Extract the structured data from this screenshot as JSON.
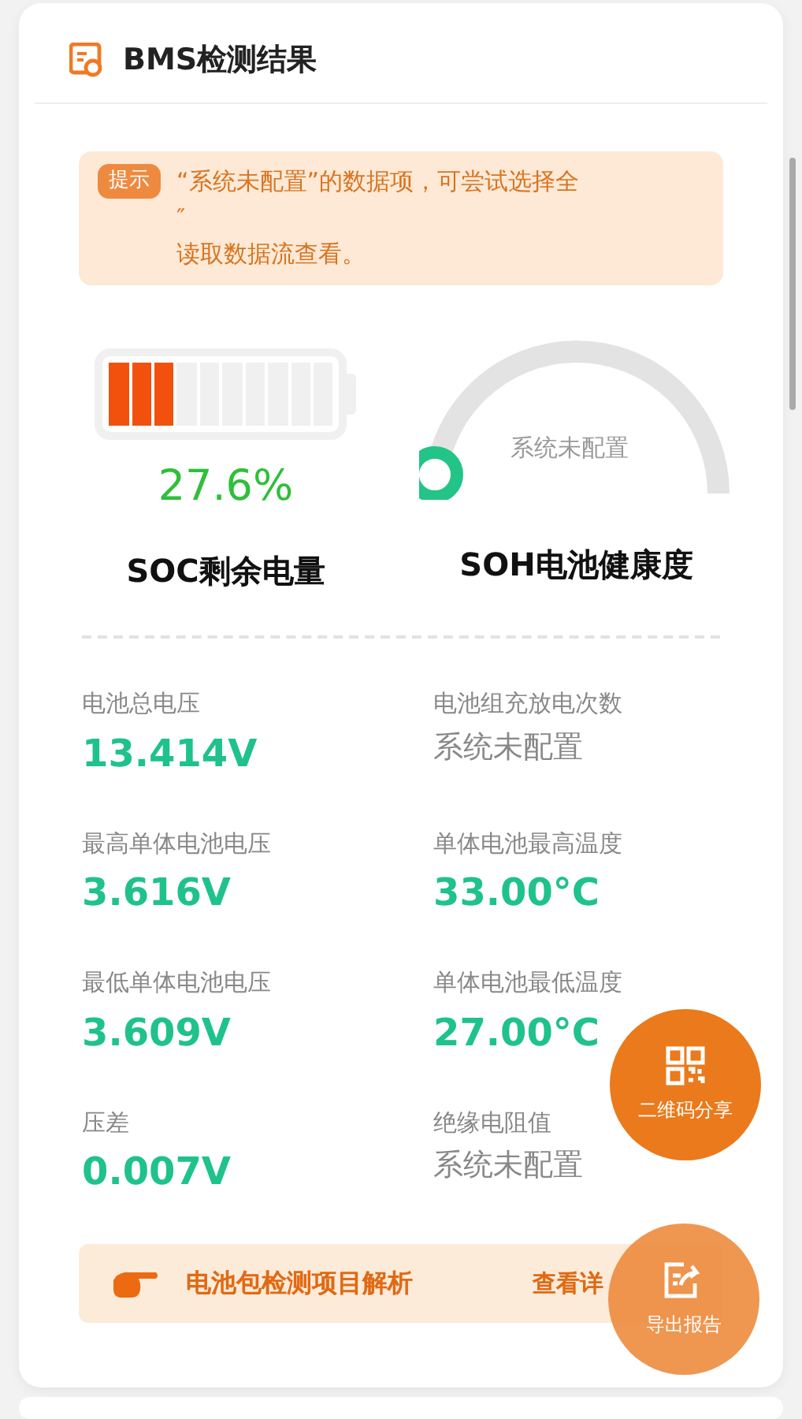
{
  "card": {
    "title": "BMS检测结果"
  },
  "hint": {
    "tag": "提示",
    "lines": [
      "“系统未配置”的数据项，可尝试选择全",
      "″",
      "读取数据流查看。"
    ]
  },
  "soc": {
    "level": 0.276,
    "reading": "27.6%",
    "label": "SOC剩余电量"
  },
  "soh": {
    "level": 0,
    "reading": "系统未配置",
    "label": "SOH电池健康度"
  },
  "metrics": [
    {
      "label": "电池总电压",
      "value": "13.414V",
      "configured": true
    },
    {
      "label": "电池组充放电次数",
      "value": "系统未配置",
      "configured": false
    },
    {
      "label": "最高单体电池电压",
      "value": "3.616V",
      "configured": true
    },
    {
      "label": "单体电池最高温度",
      "value": "33.00°C",
      "configured": true
    },
    {
      "label": "最低单体电池电压",
      "value": "3.609V",
      "configured": true
    },
    {
      "label": "单体电池最低温度",
      "value": "27.00°C",
      "configured": true
    },
    {
      "label": "压差",
      "value": "0.007V",
      "configured": true
    },
    {
      "label": "绝缘电阻值",
      "value": "系统未配置",
      "configured": false
    }
  ],
  "banner": {
    "title": "电池包检测项目解析",
    "link": "查看详"
  },
  "fabs": [
    {
      "kind": "qr",
      "label": "二维码分享"
    },
    {
      "kind": "export",
      "label": "导出报告"
    }
  ]
}
